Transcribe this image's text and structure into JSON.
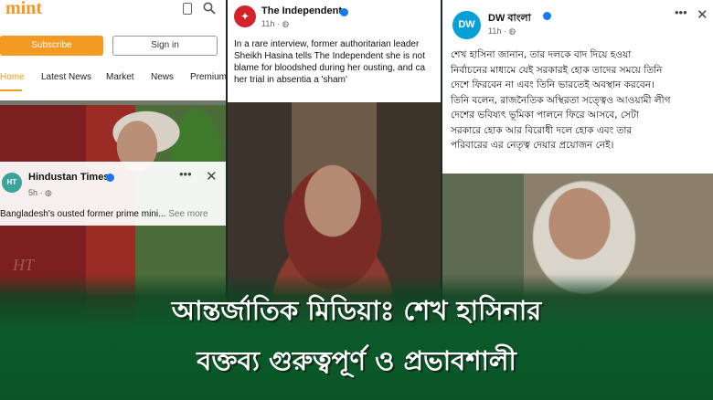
{
  "mint": {
    "logo": "mint",
    "subscribe_label": "Subscribe",
    "signin_label": "Sign in",
    "nav": [
      "Home",
      "Latest News",
      "Market",
      "News",
      "Premium"
    ],
    "active_nav": "Home"
  },
  "hindustan_times": {
    "logo_text": "HT",
    "name": "Hindustan Times",
    "time": "5h · ",
    "text": "Bangladesh's ousted former prime mini... ",
    "see_more": "See more",
    "watermark": "HT"
  },
  "independent": {
    "name": "The Independent",
    "time": "11h · ",
    "text": "In a rare interview, former authoritarian leader\nSheikh Hasina tells The Independent she is not\nblame for bloodshed during her ousting, and ca\nher trial in absentia a 'sham'"
  },
  "dw": {
    "logo_text": "DW",
    "name": "DW বাংলা",
    "time": "11h · ",
    "text": "শেখ হাসিনা জানান, তার দলকে বাদ দিয়ে হওয়া\nনির্বাচনের মাধ্যমে যেই সরকারই হোক তাদের সময়ে তিনি\nদেশে ফিরবেন না এবং তিনি ভারতেই অবস্থান করবেন।\nতিনি বলেন, রাজনৈতিক অস্থিরতা সত্ত্বেও আওয়ামী লীগ\nদেশের ভবিষ্যৎ ভূমিকা পালনে ফিরে আসবে, সেটা\nসরকারে হোক আর বিরোধী দলে হোক এবং তার\nপরিবারের এর নেতৃত্ব দেয়ার প্রয়োজন নেই।"
  },
  "headline": {
    "line1": "আন্তর্জাতিক মিডিয়াঃ শেখ হাসিনার",
    "line2": "বক্তব্য গুরুত্বপূর্ণ ও প্রভাবশালী"
  },
  "colors": {
    "mint_orange": "#f39a23",
    "banner_green": "#0b5a2a",
    "independent_red": "#d3232a",
    "dw_blue": "#05a0d8",
    "verified_blue": "#1877f2"
  }
}
